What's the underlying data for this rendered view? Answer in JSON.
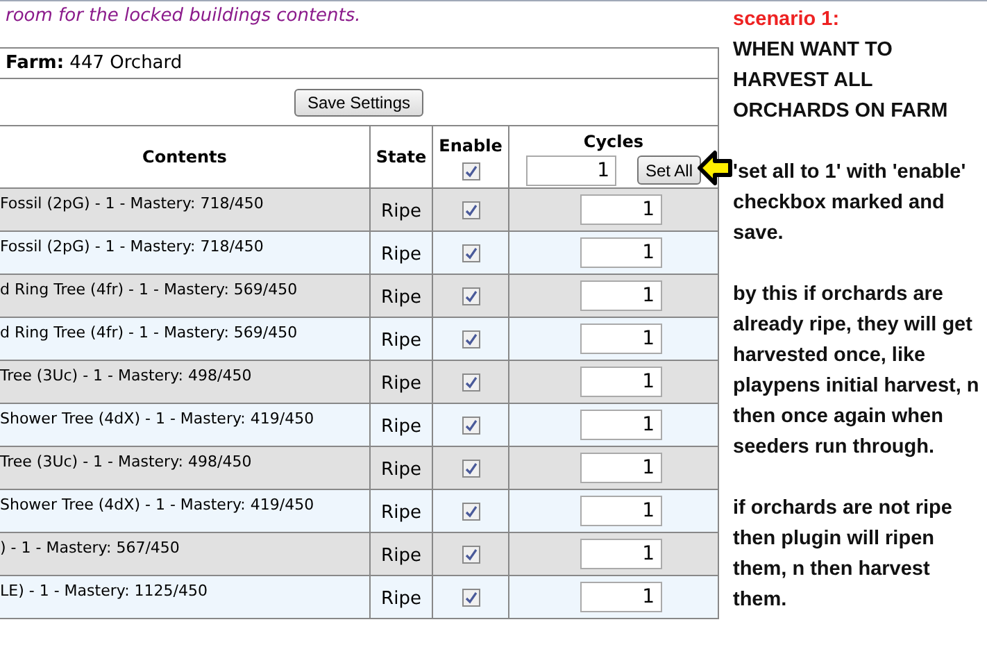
{
  "note": "room for the locked buildings contents.",
  "farm": {
    "label": "Farm:",
    "value": "447 Orchard"
  },
  "save_button": "Save Settings",
  "table": {
    "columns": [
      "Contents",
      "State",
      "Enable",
      "Cycles"
    ],
    "enable_all": {
      "checked": true
    },
    "cycles_all": {
      "value": "1",
      "button": "Set All"
    },
    "rows": [
      {
        "contents": "Fossil (2pG) - 1 - Mastery: 718/450",
        "state": "Ripe",
        "enabled": true,
        "cycles": "1"
      },
      {
        "contents": "Fossil (2pG) - 1 - Mastery: 718/450",
        "state": "Ripe",
        "enabled": true,
        "cycles": "1"
      },
      {
        "contents": "d Ring Tree (4fr) - 1 - Mastery: 569/450",
        "state": "Ripe",
        "enabled": true,
        "cycles": "1"
      },
      {
        "contents": "d Ring Tree (4fr) - 1 - Mastery: 569/450",
        "state": "Ripe",
        "enabled": true,
        "cycles": "1"
      },
      {
        "contents": "Tree (3Uc) - 1 - Mastery: 498/450",
        "state": "Ripe",
        "enabled": true,
        "cycles": "1"
      },
      {
        "contents": "Shower Tree (4dX) - 1 - Mastery: 419/450",
        "state": "Ripe",
        "enabled": true,
        "cycles": "1"
      },
      {
        "contents": "Tree (3Uc) - 1 - Mastery: 498/450",
        "state": "Ripe",
        "enabled": true,
        "cycles": "1"
      },
      {
        "contents": "Shower Tree (4dX) - 1 - Mastery: 419/450",
        "state": "Ripe",
        "enabled": true,
        "cycles": "1"
      },
      {
        "contents": ") - 1 - Mastery: 567/450",
        "state": "Ripe",
        "enabled": true,
        "cycles": "1"
      },
      {
        "contents": "LE) - 1 - Mastery: 1125/450",
        "state": "Ripe",
        "enabled": true,
        "cycles": "1"
      }
    ]
  },
  "annotation": {
    "heading": "scenario 1:",
    "paragraphs": [
      "WHEN WANT TO HARVEST ALL ORCHARDS ON FARM",
      "'set all to 1' with 'enable' checkbox marked and save.",
      "by this if orchards are already ripe, they will get harvested once, like playpens initial harvest, n then once again when seeders run through.",
      "if orchards are not ripe then plugin will ripen them, n then harvest them."
    ]
  }
}
